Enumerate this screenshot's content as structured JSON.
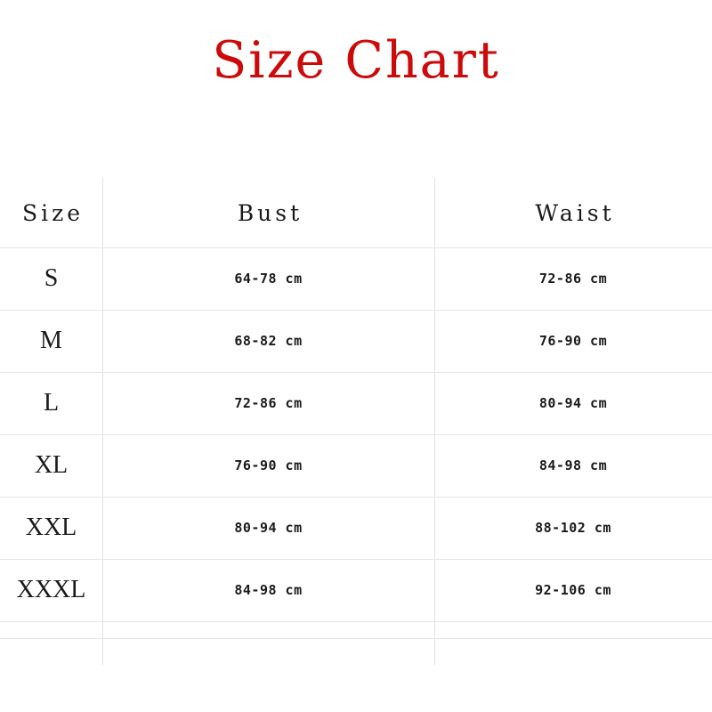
{
  "title": "Size Chart",
  "accent_color": "#cc0a0a",
  "line_color": "#e6e6e6",
  "text_color": "#1a1a1a",
  "table": {
    "columns": [
      {
        "key": "size",
        "label": "Size"
      },
      {
        "key": "bust",
        "label": "Bust"
      },
      {
        "key": "waist",
        "label": "Waist"
      }
    ],
    "rows": [
      {
        "size": "S",
        "bust": "64-78 cm",
        "waist": "72-86 cm"
      },
      {
        "size": "M",
        "bust": "68-82 cm",
        "waist": "76-90 cm"
      },
      {
        "size": "L",
        "bust": "72-86 cm",
        "waist": "80-94 cm"
      },
      {
        "size": "XL",
        "bust": "76-90 cm",
        "waist": "84-98 cm"
      },
      {
        "size": "XXL",
        "bust": "80-94 cm",
        "waist": "88-102 cm"
      },
      {
        "size": "XXXL",
        "bust": "84-98 cm",
        "waist": "92-106 cm"
      }
    ],
    "trailing_empty_rows": 1
  },
  "chart_data": {
    "type": "table",
    "title": "Size Chart",
    "columns": [
      "Size",
      "Bust",
      "Waist"
    ],
    "units": "cm",
    "rows": [
      {
        "size": "S",
        "bust": "64-78 cm",
        "waist": "72-86 cm",
        "bust_min": 64,
        "bust_max": 78,
        "waist_min": 72,
        "waist_max": 86
      },
      {
        "size": "M",
        "bust": "68-82 cm",
        "waist": "76-90 cm",
        "bust_min": 68,
        "bust_max": 82,
        "waist_min": 76,
        "waist_max": 90
      },
      {
        "size": "L",
        "bust": "72-86 cm",
        "waist": "80-94 cm",
        "bust_min": 72,
        "bust_max": 86,
        "waist_min": 80,
        "waist_max": 94
      },
      {
        "size": "XL",
        "bust": "76-90 cm",
        "waist": "84-98 cm",
        "bust_min": 76,
        "bust_max": 90,
        "waist_min": 84,
        "waist_max": 98
      },
      {
        "size": "XXL",
        "bust": "80-94 cm",
        "waist": "88-102 cm",
        "bust_min": 80,
        "bust_max": 94,
        "waist_min": 88,
        "waist_max": 102
      },
      {
        "size": "XXXL",
        "bust": "84-98 cm",
        "waist": "92-106 cm",
        "bust_min": 84,
        "bust_max": 98,
        "waist_min": 92,
        "waist_max": 106
      }
    ]
  }
}
